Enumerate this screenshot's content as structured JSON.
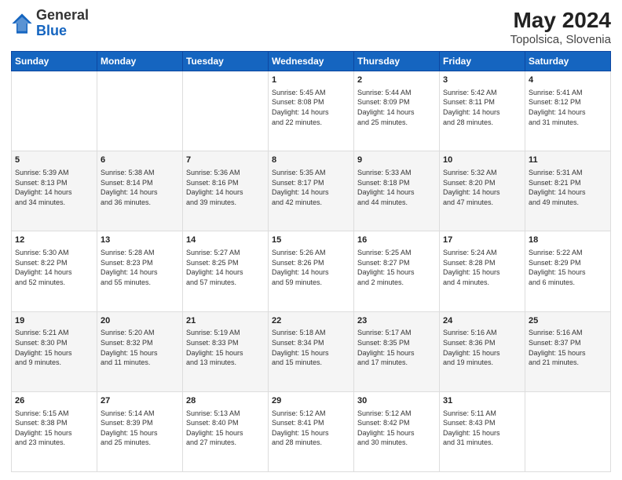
{
  "header": {
    "logo_general": "General",
    "logo_blue": "Blue",
    "month_year": "May 2024",
    "location": "Topolsica, Slovenia"
  },
  "days_of_week": [
    "Sunday",
    "Monday",
    "Tuesday",
    "Wednesday",
    "Thursday",
    "Friday",
    "Saturday"
  ],
  "weeks": [
    [
      {
        "day": "",
        "info": ""
      },
      {
        "day": "",
        "info": ""
      },
      {
        "day": "",
        "info": ""
      },
      {
        "day": "1",
        "info": "Sunrise: 5:45 AM\nSunset: 8:08 PM\nDaylight: 14 hours\nand 22 minutes."
      },
      {
        "day": "2",
        "info": "Sunrise: 5:44 AM\nSunset: 8:09 PM\nDaylight: 14 hours\nand 25 minutes."
      },
      {
        "day": "3",
        "info": "Sunrise: 5:42 AM\nSunset: 8:11 PM\nDaylight: 14 hours\nand 28 minutes."
      },
      {
        "day": "4",
        "info": "Sunrise: 5:41 AM\nSunset: 8:12 PM\nDaylight: 14 hours\nand 31 minutes."
      }
    ],
    [
      {
        "day": "5",
        "info": "Sunrise: 5:39 AM\nSunset: 8:13 PM\nDaylight: 14 hours\nand 34 minutes."
      },
      {
        "day": "6",
        "info": "Sunrise: 5:38 AM\nSunset: 8:14 PM\nDaylight: 14 hours\nand 36 minutes."
      },
      {
        "day": "7",
        "info": "Sunrise: 5:36 AM\nSunset: 8:16 PM\nDaylight: 14 hours\nand 39 minutes."
      },
      {
        "day": "8",
        "info": "Sunrise: 5:35 AM\nSunset: 8:17 PM\nDaylight: 14 hours\nand 42 minutes."
      },
      {
        "day": "9",
        "info": "Sunrise: 5:33 AM\nSunset: 8:18 PM\nDaylight: 14 hours\nand 44 minutes."
      },
      {
        "day": "10",
        "info": "Sunrise: 5:32 AM\nSunset: 8:20 PM\nDaylight: 14 hours\nand 47 minutes."
      },
      {
        "day": "11",
        "info": "Sunrise: 5:31 AM\nSunset: 8:21 PM\nDaylight: 14 hours\nand 49 minutes."
      }
    ],
    [
      {
        "day": "12",
        "info": "Sunrise: 5:30 AM\nSunset: 8:22 PM\nDaylight: 14 hours\nand 52 minutes."
      },
      {
        "day": "13",
        "info": "Sunrise: 5:28 AM\nSunset: 8:23 PM\nDaylight: 14 hours\nand 55 minutes."
      },
      {
        "day": "14",
        "info": "Sunrise: 5:27 AM\nSunset: 8:25 PM\nDaylight: 14 hours\nand 57 minutes."
      },
      {
        "day": "15",
        "info": "Sunrise: 5:26 AM\nSunset: 8:26 PM\nDaylight: 14 hours\nand 59 minutes."
      },
      {
        "day": "16",
        "info": "Sunrise: 5:25 AM\nSunset: 8:27 PM\nDaylight: 15 hours\nand 2 minutes."
      },
      {
        "day": "17",
        "info": "Sunrise: 5:24 AM\nSunset: 8:28 PM\nDaylight: 15 hours\nand 4 minutes."
      },
      {
        "day": "18",
        "info": "Sunrise: 5:22 AM\nSunset: 8:29 PM\nDaylight: 15 hours\nand 6 minutes."
      }
    ],
    [
      {
        "day": "19",
        "info": "Sunrise: 5:21 AM\nSunset: 8:30 PM\nDaylight: 15 hours\nand 9 minutes."
      },
      {
        "day": "20",
        "info": "Sunrise: 5:20 AM\nSunset: 8:32 PM\nDaylight: 15 hours\nand 11 minutes."
      },
      {
        "day": "21",
        "info": "Sunrise: 5:19 AM\nSunset: 8:33 PM\nDaylight: 15 hours\nand 13 minutes."
      },
      {
        "day": "22",
        "info": "Sunrise: 5:18 AM\nSunset: 8:34 PM\nDaylight: 15 hours\nand 15 minutes."
      },
      {
        "day": "23",
        "info": "Sunrise: 5:17 AM\nSunset: 8:35 PM\nDaylight: 15 hours\nand 17 minutes."
      },
      {
        "day": "24",
        "info": "Sunrise: 5:16 AM\nSunset: 8:36 PM\nDaylight: 15 hours\nand 19 minutes."
      },
      {
        "day": "25",
        "info": "Sunrise: 5:16 AM\nSunset: 8:37 PM\nDaylight: 15 hours\nand 21 minutes."
      }
    ],
    [
      {
        "day": "26",
        "info": "Sunrise: 5:15 AM\nSunset: 8:38 PM\nDaylight: 15 hours\nand 23 minutes."
      },
      {
        "day": "27",
        "info": "Sunrise: 5:14 AM\nSunset: 8:39 PM\nDaylight: 15 hours\nand 25 minutes."
      },
      {
        "day": "28",
        "info": "Sunrise: 5:13 AM\nSunset: 8:40 PM\nDaylight: 15 hours\nand 27 minutes."
      },
      {
        "day": "29",
        "info": "Sunrise: 5:12 AM\nSunset: 8:41 PM\nDaylight: 15 hours\nand 28 minutes."
      },
      {
        "day": "30",
        "info": "Sunrise: 5:12 AM\nSunset: 8:42 PM\nDaylight: 15 hours\nand 30 minutes."
      },
      {
        "day": "31",
        "info": "Sunrise: 5:11 AM\nSunset: 8:43 PM\nDaylight: 15 hours\nand 31 minutes."
      },
      {
        "day": "",
        "info": ""
      }
    ]
  ]
}
